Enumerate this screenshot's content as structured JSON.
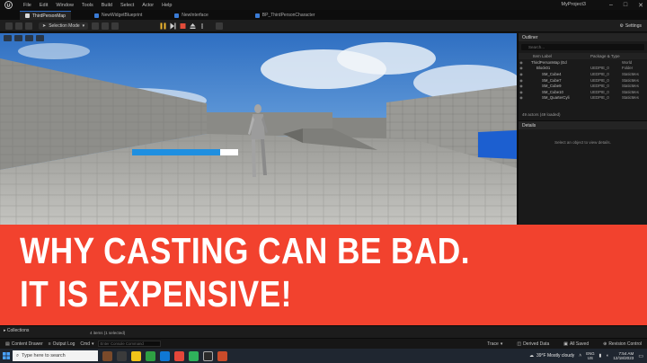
{
  "window": {
    "menu": [
      "File",
      "Edit",
      "Window",
      "Tools",
      "Build",
      "Select",
      "Actor",
      "Help"
    ],
    "project": "MyProject3",
    "controls": [
      "–",
      "□",
      "✕"
    ]
  },
  "tabs": [
    {
      "label": "ThirdPersonMap",
      "active": true,
      "color": "#d9d9d9"
    },
    {
      "label": "NewWidgetBlueprint",
      "active": false,
      "color": "#3a7bd5"
    },
    {
      "label": "NewInterface",
      "active": false,
      "color": "#3a7bd5"
    },
    {
      "label": "BP_ThirdPersonCharacter",
      "active": false,
      "color": "#3a7bd5"
    }
  ],
  "toolbar": {
    "selection_mode": "Selection Mode",
    "settings": "Settings"
  },
  "outliner": {
    "title": "Outliner",
    "search_placeholder": "Search...",
    "col_label": "Item Label",
    "col_type": "Package & Type",
    "rows": [
      {
        "label": "ThirdPersonMap (Ed",
        "package": "",
        "type": "World",
        "indent": 1,
        "selected": false
      },
      {
        "label": "Block01",
        "package": "UEDPIE_0",
        "type": "Folder",
        "indent": 2,
        "selected": false
      },
      {
        "label": "SM_Cube4",
        "package": "UEDPIE_0",
        "type": "StaticMes",
        "indent": 3,
        "selected": false
      },
      {
        "label": "SM_Cube7",
        "package": "UEDPIE_0",
        "type": "StaticMes",
        "indent": 3,
        "selected": false
      },
      {
        "label": "SM_Cube9",
        "package": "UEDPIE_0",
        "type": "StaticMes",
        "indent": 3,
        "selected": false
      },
      {
        "label": "SM_Cube10",
        "package": "UEDPIE_0",
        "type": "StaticMes",
        "indent": 3,
        "selected": false
      },
      {
        "label": "SM_QuarterCyli",
        "package": "UEDPIE_0",
        "type": "StaticMes",
        "indent": 3,
        "selected": false
      }
    ],
    "actors_count": "49 actors (49 loaded)"
  },
  "details": {
    "title": "Details",
    "empty_text": "Select an object to view details."
  },
  "banner": {
    "line1": "WHY CASTING CAN BE BAD.",
    "line2": "IT IS EXPENSIVE!"
  },
  "bottom": {
    "collections": "Collections",
    "items_count": "4 items (1 selected)"
  },
  "statusbar": {
    "content_drawer": "Content Drawer",
    "output_log": "Output Log",
    "cmd": "Cmd",
    "cmd_placeholder": "Enter Console Command",
    "trace": "Trace",
    "derived_data": "Derived Data",
    "all_saved": "All Saved",
    "revision_control": "Revision Control"
  },
  "taskbar": {
    "search": "Type here to search",
    "weather": "39°F  Mostly cloudy",
    "lang_top": "ENG",
    "lang_bottom": "US",
    "time": "7:54 AM",
    "date": "12/18/2023"
  },
  "colors": {
    "banner": "#f2422e",
    "accent": "#2a6bc6",
    "health_bar": "#1f8fe0"
  }
}
